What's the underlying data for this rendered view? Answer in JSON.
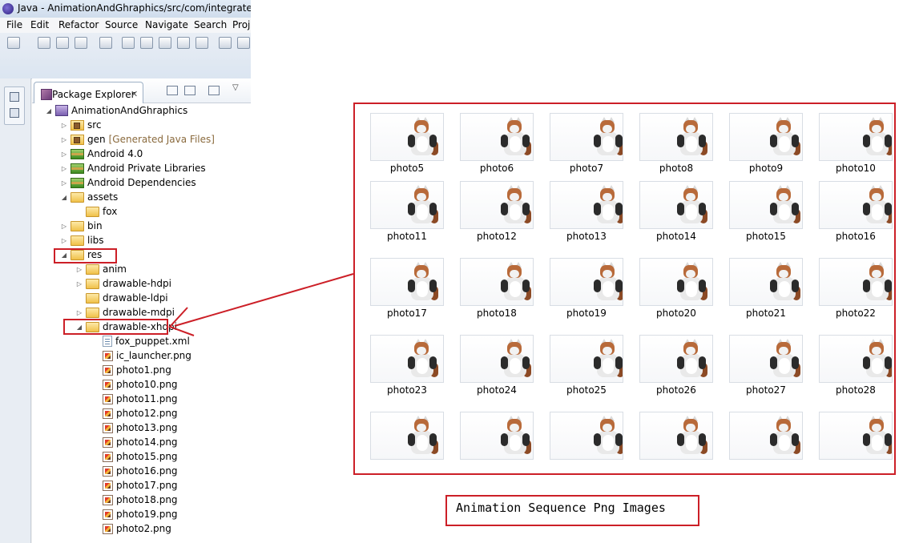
{
  "window": {
    "title": "Java - AnimationAndGhraphics/src/com/integratedidea"
  },
  "menubar": {
    "items": [
      "File",
      "Edit",
      "Refactor",
      "Source",
      "Navigate",
      "Search",
      "Proj"
    ]
  },
  "package_explorer": {
    "tab_label": "Package Explorer",
    "tree": [
      {
        "label": "AnimationAndGhraphics",
        "icon": "project-icon",
        "arrow": "expanded",
        "decoration": ""
      },
      {
        "label": "src",
        "icon": "package-folder-icon",
        "arrow": "collapsed",
        "decoration": ""
      },
      {
        "label": "gen",
        "icon": "package-folder-icon",
        "arrow": "collapsed",
        "decoration": "[Generated Java Files]"
      },
      {
        "label": "Android 4.0",
        "icon": "library-icon",
        "arrow": "collapsed",
        "decoration": ""
      },
      {
        "label": "Android Private Libraries",
        "icon": "library-icon",
        "arrow": "collapsed",
        "decoration": ""
      },
      {
        "label": "Android Dependencies",
        "icon": "library-icon",
        "arrow": "collapsed",
        "decoration": ""
      },
      {
        "label": "assets",
        "icon": "folder-icon",
        "arrow": "expanded",
        "decoration": ""
      },
      {
        "label": "fox",
        "icon": "folder-icon",
        "arrow": "none",
        "decoration": ""
      },
      {
        "label": "bin",
        "icon": "folder-icon",
        "arrow": "collapsed",
        "decoration": ""
      },
      {
        "label": "libs",
        "icon": "folder-icon",
        "arrow": "collapsed",
        "decoration": ""
      },
      {
        "label": "res",
        "icon": "folder-icon",
        "arrow": "expanded",
        "decoration": ""
      },
      {
        "label": "anim",
        "icon": "folder-icon",
        "arrow": "collapsed",
        "decoration": ""
      },
      {
        "label": "drawable-hdpi",
        "icon": "folder-icon",
        "arrow": "collapsed",
        "decoration": ""
      },
      {
        "label": "drawable-ldpi",
        "icon": "folder-icon",
        "arrow": "none",
        "decoration": ""
      },
      {
        "label": "drawable-mdpi",
        "icon": "folder-icon",
        "arrow": "collapsed",
        "decoration": ""
      },
      {
        "label": "drawable-xhdpi",
        "icon": "folder-icon",
        "arrow": "expanded",
        "decoration": ""
      },
      {
        "label": "fox_puppet.xml",
        "icon": "xml-file-icon",
        "arrow": "none",
        "decoration": ""
      },
      {
        "label": "ic_launcher.png",
        "icon": "png-file-icon",
        "arrow": "none",
        "decoration": ""
      },
      {
        "label": "photo1.png",
        "icon": "png-file-icon",
        "arrow": "none",
        "decoration": ""
      },
      {
        "label": "photo10.png",
        "icon": "png-file-icon",
        "arrow": "none",
        "decoration": ""
      },
      {
        "label": "photo11.png",
        "icon": "png-file-icon",
        "arrow": "none",
        "decoration": ""
      },
      {
        "label": "photo12.png",
        "icon": "png-file-icon",
        "arrow": "none",
        "decoration": ""
      },
      {
        "label": "photo13.png",
        "icon": "png-file-icon",
        "arrow": "none",
        "decoration": ""
      },
      {
        "label": "photo14.png",
        "icon": "png-file-icon",
        "arrow": "none",
        "decoration": ""
      },
      {
        "label": "photo15.png",
        "icon": "png-file-icon",
        "arrow": "none",
        "decoration": ""
      },
      {
        "label": "photo16.png",
        "icon": "png-file-icon",
        "arrow": "none",
        "decoration": ""
      },
      {
        "label": "photo17.png",
        "icon": "png-file-icon",
        "arrow": "none",
        "decoration": ""
      },
      {
        "label": "photo18.png",
        "icon": "png-file-icon",
        "arrow": "none",
        "decoration": ""
      },
      {
        "label": "photo19.png",
        "icon": "png-file-icon",
        "arrow": "none",
        "decoration": ""
      },
      {
        "label": "photo2.png",
        "icon": "png-file-icon",
        "arrow": "none",
        "decoration": ""
      }
    ]
  },
  "gallery": {
    "rows": [
      [
        "photo5",
        "photo6",
        "photo7",
        "photo8",
        "photo9",
        "photo10"
      ],
      [
        "photo11",
        "photo12",
        "photo13",
        "photo14",
        "photo15",
        "photo16"
      ],
      [
        "photo17",
        "photo18",
        "photo19",
        "photo20",
        "photo21",
        "photo22"
      ],
      [
        "photo23",
        "photo24",
        "photo25",
        "photo26",
        "photo27",
        "photo28"
      ],
      [
        "",
        "",
        "",
        "",
        "",
        ""
      ]
    ]
  },
  "annotation": {
    "caption": "Animation Sequence Png Images",
    "highlight_color": "#cc1f27"
  }
}
